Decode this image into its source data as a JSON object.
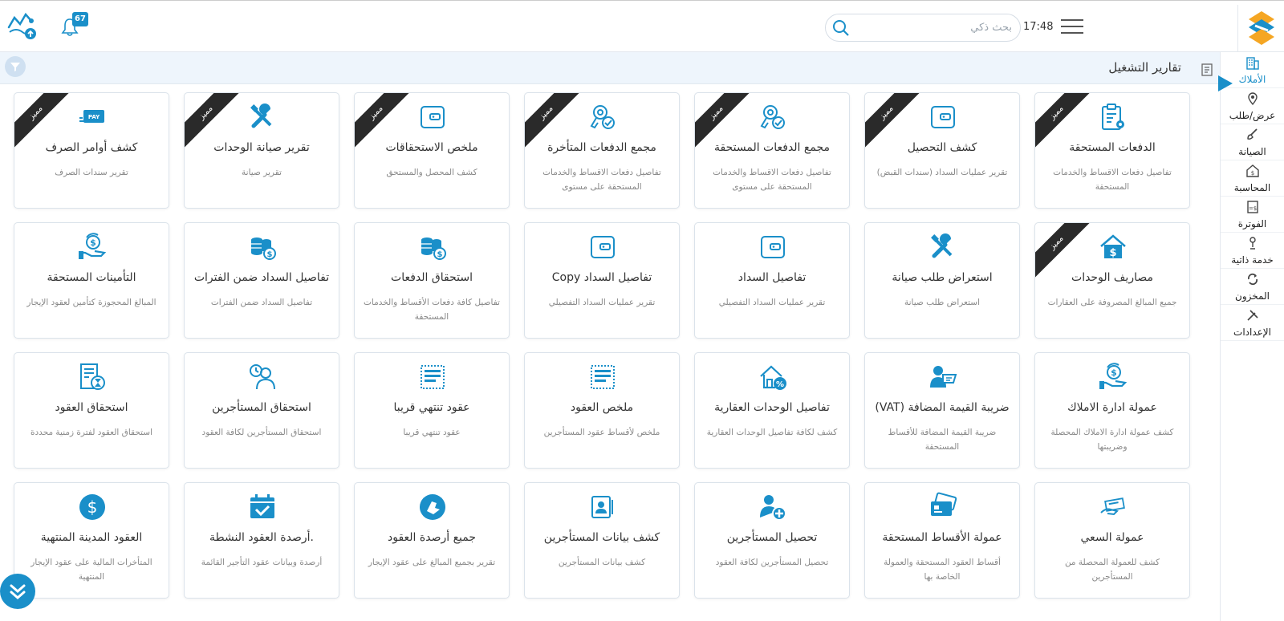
{
  "header": {
    "time": "17:48",
    "search_placeholder": "بحث ذكي",
    "notification_count": "67"
  },
  "page": {
    "title": "تقارير التشغيل"
  },
  "sidebar": {
    "items": [
      {
        "label": "الأملاك",
        "icon": "building-icon"
      },
      {
        "label": "عرض/طلب",
        "icon": "map-pin-icon"
      },
      {
        "label": "الصيانة",
        "icon": "brush-icon"
      },
      {
        "label": "المحاسبة",
        "icon": "dollar-house-icon"
      },
      {
        "label": "الفوترة",
        "icon": "invoice-icon"
      },
      {
        "label": "خدمة ذاتية",
        "icon": "user-touch-icon"
      },
      {
        "label": "المخزون",
        "icon": "inventory-cycle-icon"
      },
      {
        "label": "الإعدادات",
        "icon": "tools-icon"
      }
    ]
  },
  "badge_label": "مميز",
  "cards": [
    {
      "title": "الدفعات المستحقة",
      "desc": "تفاصيل دفعات الاقساط والخدمات المستحقة",
      "icon": "clipboard-gear-icon",
      "featured": true
    },
    {
      "title": "كشف التحصيل",
      "desc": "تقرير عمليات السداد (سندات القبض)",
      "icon": "wallet-icon",
      "featured": true
    },
    {
      "title": "مجمع الدفعات المستحقة",
      "desc": "تفاصيل دفعات الاقساط والخدمات المستحقة على مستوى",
      "icon": "key-check-icon",
      "featured": true
    },
    {
      "title": "مجمع الدفعات المتأخرة",
      "desc": "تفاصيل دفعات الاقساط والخدمات المستحقة على مستوى",
      "icon": "key-check-icon",
      "featured": true
    },
    {
      "title": "ملخص الاستحقاقات",
      "desc": "كشف المحصل والمستحق",
      "icon": "wallet-icon",
      "featured": true
    },
    {
      "title": "تقرير صيانة الوحدات",
      "desc": "تقرير صيانة",
      "icon": "tools-icon",
      "featured": true
    },
    {
      "title": "كشف أوامر الصرف",
      "desc": "تقرير سندات الصرف",
      "icon": "pay-card-icon",
      "featured": true
    },
    {
      "title": "مصاريف الوحدات",
      "desc": "جميع المبالغ المصروفة على العقارات",
      "icon": "house-dollar-icon",
      "featured": true
    },
    {
      "title": "استعراض طلب صيانة",
      "desc": "استعراض طلب صيانة",
      "icon": "tools-icon",
      "featured": false
    },
    {
      "title": "تفاصيل السداد",
      "desc": "تقرير عمليات السداد التفصيلي",
      "icon": "wallet-icon",
      "featured": false
    },
    {
      "title": "تفاصيل السداد Copy",
      "desc": "تقرير عمليات السداد التفصيلي",
      "icon": "wallet-icon",
      "featured": false
    },
    {
      "title": "استحقاق الدفعات",
      "desc": "تفاصيل كافة دفعات الأقساط والخدمات المستحقة",
      "icon": "coins-icon",
      "featured": false
    },
    {
      "title": "تفاصيل السداد ضمن الفترات",
      "desc": "تفاصيل السداد ضمن الفترات",
      "icon": "coins-icon",
      "featured": false
    },
    {
      "title": "التأمينات المستحقة",
      "desc": "المبالغ المحجوزة كتأمين لعقود الإيجار",
      "icon": "hand-dollar-icon",
      "featured": false
    },
    {
      "title": "عمولة ادارة الاملاك",
      "desc": "كشف عمولة ادارة الاملاك المحصلة وضريبتها",
      "icon": "hand-dollar-icon",
      "featured": false
    },
    {
      "title": "ضريبة القيمة المضافة (VAT)",
      "desc": "ضريبة القيمة المضافة للأقساط المستحقة",
      "icon": "person-card-icon",
      "featured": false
    },
    {
      "title": "تفاصيل الوحدات العقارية",
      "desc": "كشف لكافة تفاصيل الوحدات العقارية",
      "icon": "house-percent-icon",
      "featured": false
    },
    {
      "title": "ملخص العقود",
      "desc": "ملخص لأقساط عقود المستأجرين",
      "icon": "doc-lines-icon",
      "featured": false
    },
    {
      "title": "عقود تنتهي قريبا",
      "desc": "عقود تنتهي قريبا",
      "icon": "doc-lines-icon",
      "featured": false
    },
    {
      "title": "استحقاق المستأجرين",
      "desc": "استحقاق المستأجرين لكافة العقود",
      "icon": "person-clock-icon",
      "featured": false
    },
    {
      "title": "استحقاق العقود",
      "desc": "استحقاق العقود لفترة زمنية محددة",
      "icon": "doc-hourglass-icon",
      "featured": false
    },
    {
      "title": "عمولة السعي",
      "desc": "كشف للعمولة المحصلة من المستأجرين",
      "icon": "hand-card-icon",
      "featured": false
    },
    {
      "title": "عمولة الأقساط المستحقة",
      "desc": "أقساط العقود المستحقة والعمولة الخاصة بها",
      "icon": "credit-card-icon",
      "featured": false
    },
    {
      "title": "تحصيل المستأجرين",
      "desc": "تحصيل المستأجرين لكافة العقود",
      "icon": "person-plus-icon",
      "featured": false
    },
    {
      "title": "كشف بيانات المستأجرين",
      "desc": "كشف بيانات المستأجرين",
      "icon": "contact-card-icon",
      "featured": false
    },
    {
      "title": "جميع أرصدة العقود",
      "desc": "تقرير بجميع المبالغ على عقود الإيجار",
      "icon": "circle-hand-icon",
      "featured": false
    },
    {
      "title": ".أرصدة العقود النشطة",
      "desc": "أرصدة وبيانات عقود التأجير القائمة",
      "icon": "calendar-check-icon",
      "featured": false
    },
    {
      "title": "العقود المدينة المنتهية",
      "desc": "المتأخرات المالية على عقود الإيجار المنتهية",
      "icon": "circle-dollar-icon",
      "featured": false
    }
  ],
  "colors": {
    "accent": "#1a8fc9",
    "ribbon": "#2a2a2a",
    "pagebar": "#eef5fc"
  }
}
